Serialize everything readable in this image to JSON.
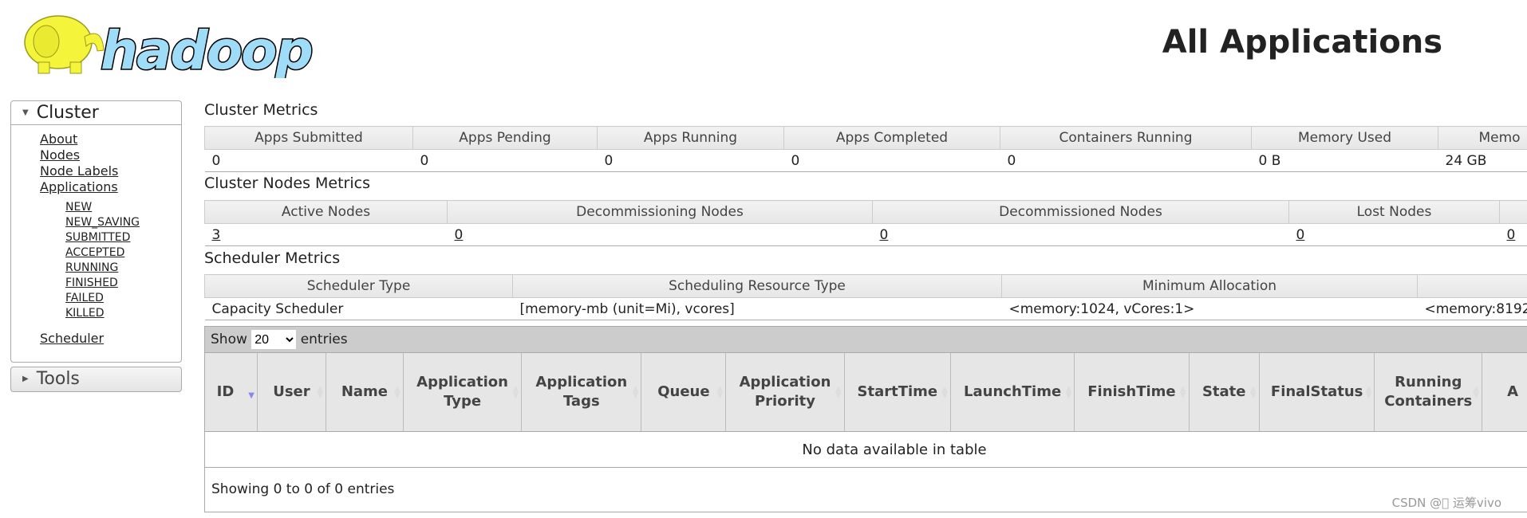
{
  "header": {
    "logo_text": "hadoop",
    "title": "All Applications"
  },
  "sidebar": {
    "cluster_label": "Cluster",
    "links": [
      "About",
      "Nodes",
      "Node Labels",
      "Applications"
    ],
    "app_states": [
      "NEW",
      "NEW_SAVING",
      "SUBMITTED",
      "ACCEPTED",
      "RUNNING",
      "FINISHED",
      "FAILED",
      "KILLED"
    ],
    "scheduler": "Scheduler",
    "tools_label": "Tools"
  },
  "cluster_metrics": {
    "title": "Cluster Metrics",
    "headers": [
      "Apps Submitted",
      "Apps Pending",
      "Apps Running",
      "Apps Completed",
      "Containers Running",
      "Memory Used",
      "Memo"
    ],
    "values": [
      "0",
      "0",
      "0",
      "0",
      "0",
      "0 B",
      "24 GB"
    ]
  },
  "node_metrics": {
    "title": "Cluster Nodes Metrics",
    "headers": [
      "Active Nodes",
      "Decommissioning Nodes",
      "Decommissioned Nodes",
      "Lost Nodes",
      ""
    ],
    "values": [
      "3",
      "0",
      "0",
      "0",
      "0"
    ]
  },
  "scheduler_metrics": {
    "title": "Scheduler Metrics",
    "headers": [
      "Scheduler Type",
      "Scheduling Resource Type",
      "Minimum Allocation",
      ""
    ],
    "values": [
      "Capacity Scheduler",
      "[memory-mb (unit=Mi), vcores]",
      "<memory:1024, vCores:1>",
      "<memory:8192"
    ]
  },
  "apps_table": {
    "show_label": "Show",
    "entries_label": "entries",
    "page_size": "20",
    "columns": [
      "ID",
      "User",
      "Name",
      "Application Type",
      "Application Tags",
      "Queue",
      "Application Priority",
      "StartTime",
      "LaunchTime",
      "FinishTime",
      "State",
      "FinalStatus",
      "Running Containers",
      "A"
    ],
    "empty_text": "No data available in table",
    "info": "Showing 0 to 0 of 0 entries"
  },
  "watermark": "CSDN @\u0000 运筹vivo"
}
